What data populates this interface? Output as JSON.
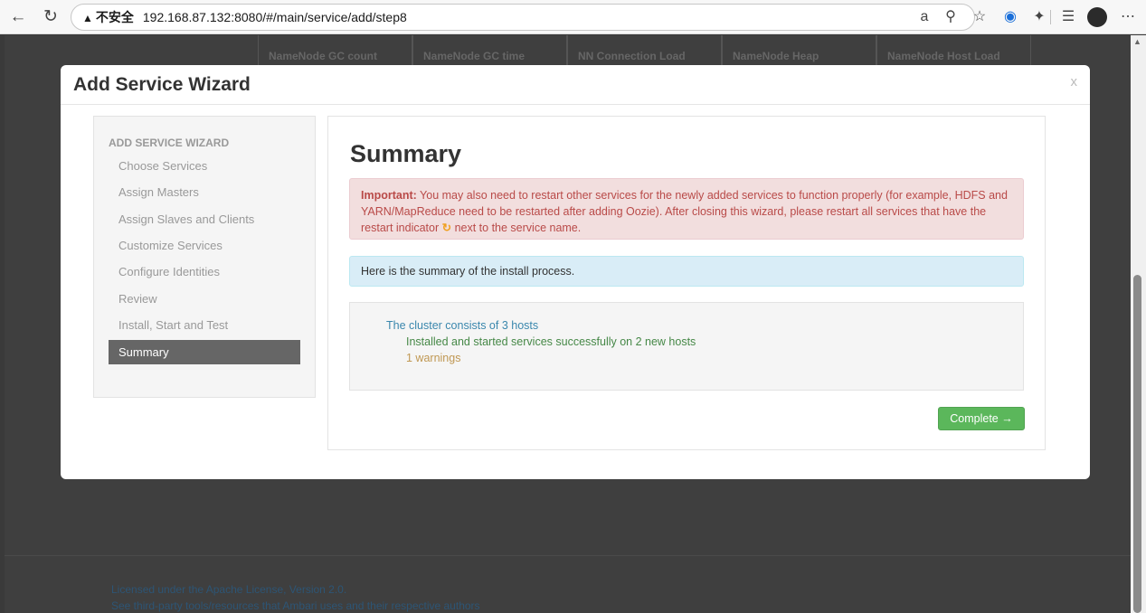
{
  "browser": {
    "back_glyph": "←",
    "reload_glyph": "↻",
    "security_warning": "不安全",
    "url": "192.168.87.132:8080/#/main/service/add/step8",
    "icons": [
      "read-aloud-icon",
      "zoom-icon",
      "favorite-star-icon",
      "extension-icon",
      "puzzle-icon",
      "favorites-list-icon",
      "profile-avatar",
      "more-icon"
    ]
  },
  "background": {
    "metric_headers": [
      "NameNode GC count",
      "NameNode GC time",
      "NN Connection Load",
      "NameNode Heap",
      "NameNode Host Load"
    ],
    "footer_license": "Licensed under the Apache License, Version 2.0.",
    "footer_thirdparty": "See third-party tools/resources that Ambari uses and their respective authors"
  },
  "modal": {
    "title": "Add Service Wizard",
    "close_label": "x"
  },
  "sidebar": {
    "header": "ADD SERVICE WIZARD",
    "items": [
      {
        "label": "Choose Services"
      },
      {
        "label": "Assign Masters"
      },
      {
        "label": "Assign Slaves and Clients"
      },
      {
        "label": "Customize Services"
      },
      {
        "label": "Configure Identities"
      },
      {
        "label": "Review"
      },
      {
        "label": "Install, Start and Test"
      },
      {
        "label": "Summary"
      }
    ],
    "active_index": 7
  },
  "main": {
    "title": "Summary",
    "important_label": "Important:",
    "important_text_1": " You may also need to restart other services for the newly added services to function properly (for example, HDFS and YARN/MapReduce need to be restarted after adding Oozie). After closing this wizard, please restart all services that have the restart indicator ",
    "restart_indicator_glyph": "↻",
    "important_text_2": " next to the service name.",
    "info_text": "Here is the summary of the install process.",
    "summary": {
      "hosts_line": "The cluster consists of 3 hosts",
      "success_line": "Installed and started services successfully on 2 new hosts",
      "warnings_line": "1 warnings"
    },
    "complete_button": "Complete →"
  },
  "colors": {
    "active_sidebar": "#666666",
    "error_bg": "#f2dede",
    "error_text": "#b94a48",
    "info_bg": "#d9edf7",
    "success_text": "#468847",
    "warning_text": "#c09853",
    "hosts_text": "#3a87ad",
    "complete_button": "#5bb75b"
  }
}
